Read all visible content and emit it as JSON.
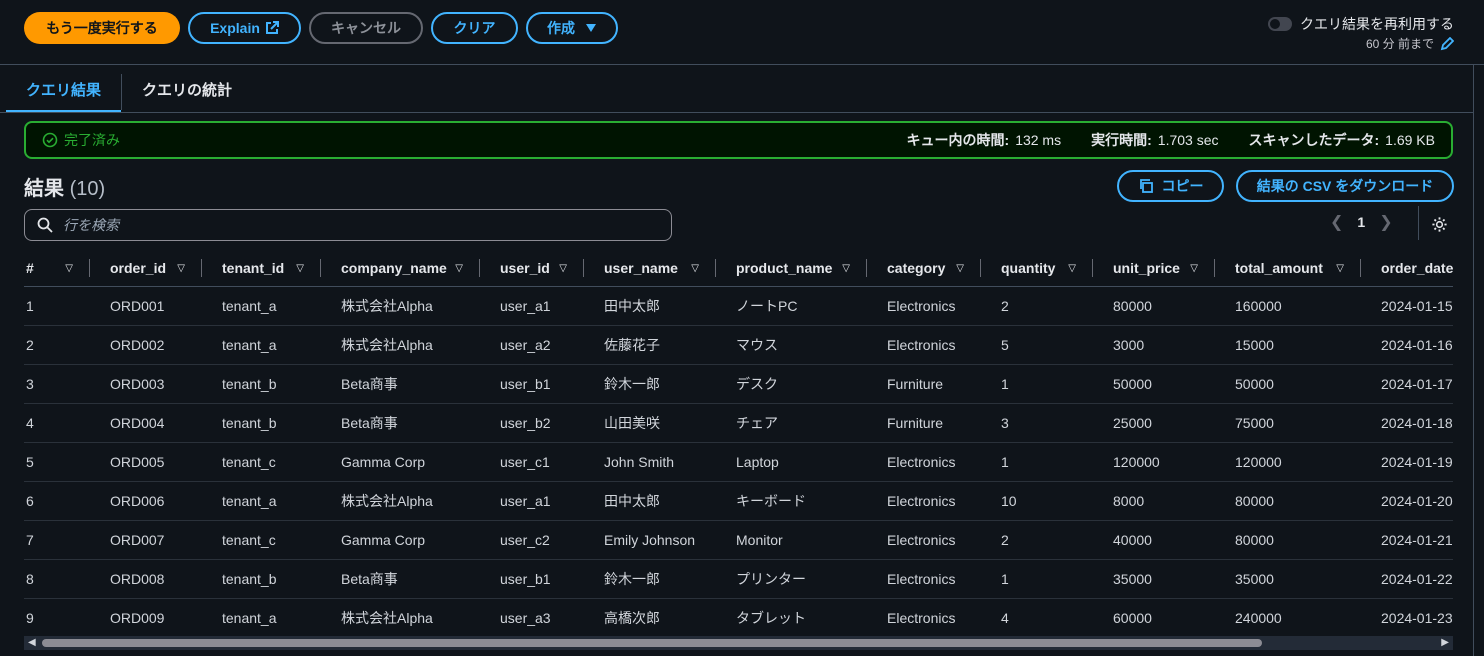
{
  "toolbar": {
    "run_again": "もう一度実行する",
    "explain": "Explain",
    "cancel": "キャンセル",
    "clear": "クリア",
    "create": "作成",
    "reuse_label": "クエリ結果を再利用する",
    "reuse_sub": "60 分 前まで"
  },
  "tabs": [
    "クエリ結果",
    "クエリの統計"
  ],
  "status": {
    "state": "完了済み",
    "queue_label": "キュー内の時間:",
    "queue_value": "132 ms",
    "exec_label": "実行時間:",
    "exec_value": "1.703 sec",
    "scan_label": "スキャンしたデータ:",
    "scan_value": "1.69 KB"
  },
  "results": {
    "title": "結果",
    "count": "(10)",
    "copy": "コピー",
    "download": "結果の CSV をダウンロード",
    "search_placeholder": "行を検索",
    "page": "1"
  },
  "table": {
    "columns": [
      "#",
      "order_id",
      "tenant_id",
      "company_name",
      "user_id",
      "user_name",
      "product_name",
      "category",
      "quantity",
      "unit_price",
      "total_amount",
      "order_date"
    ],
    "rows": [
      [
        "1",
        "ORD001",
        "tenant_a",
        "株式会社Alpha",
        "user_a1",
        "田中太郎",
        "ノートPC",
        "Electronics",
        "2",
        "80000",
        "160000",
        "2024-01-15"
      ],
      [
        "2",
        "ORD002",
        "tenant_a",
        "株式会社Alpha",
        "user_a2",
        "佐藤花子",
        "マウス",
        "Electronics",
        "5",
        "3000",
        "15000",
        "2024-01-16"
      ],
      [
        "3",
        "ORD003",
        "tenant_b",
        "Beta商事",
        "user_b1",
        "鈴木一郎",
        "デスク",
        "Furniture",
        "1",
        "50000",
        "50000",
        "2024-01-17"
      ],
      [
        "4",
        "ORD004",
        "tenant_b",
        "Beta商事",
        "user_b2",
        "山田美咲",
        "チェア",
        "Furniture",
        "3",
        "25000",
        "75000",
        "2024-01-18"
      ],
      [
        "5",
        "ORD005",
        "tenant_c",
        "Gamma Corp",
        "user_c1",
        "John Smith",
        "Laptop",
        "Electronics",
        "1",
        "120000",
        "120000",
        "2024-01-19"
      ],
      [
        "6",
        "ORD006",
        "tenant_a",
        "株式会社Alpha",
        "user_a1",
        "田中太郎",
        "キーボード",
        "Electronics",
        "10",
        "8000",
        "80000",
        "2024-01-20"
      ],
      [
        "7",
        "ORD007",
        "tenant_c",
        "Gamma Corp",
        "user_c2",
        "Emily Johnson",
        "Monitor",
        "Electronics",
        "2",
        "40000",
        "80000",
        "2024-01-21"
      ],
      [
        "8",
        "ORD008",
        "tenant_b",
        "Beta商事",
        "user_b1",
        "鈴木一郎",
        "プリンター",
        "Electronics",
        "1",
        "35000",
        "35000",
        "2024-01-22"
      ],
      [
        "9",
        "ORD009",
        "tenant_a",
        "株式会社Alpha",
        "user_a3",
        "高橋次郎",
        "タブレット",
        "Electronics",
        "4",
        "60000",
        "240000",
        "2024-01-23"
      ]
    ]
  }
}
